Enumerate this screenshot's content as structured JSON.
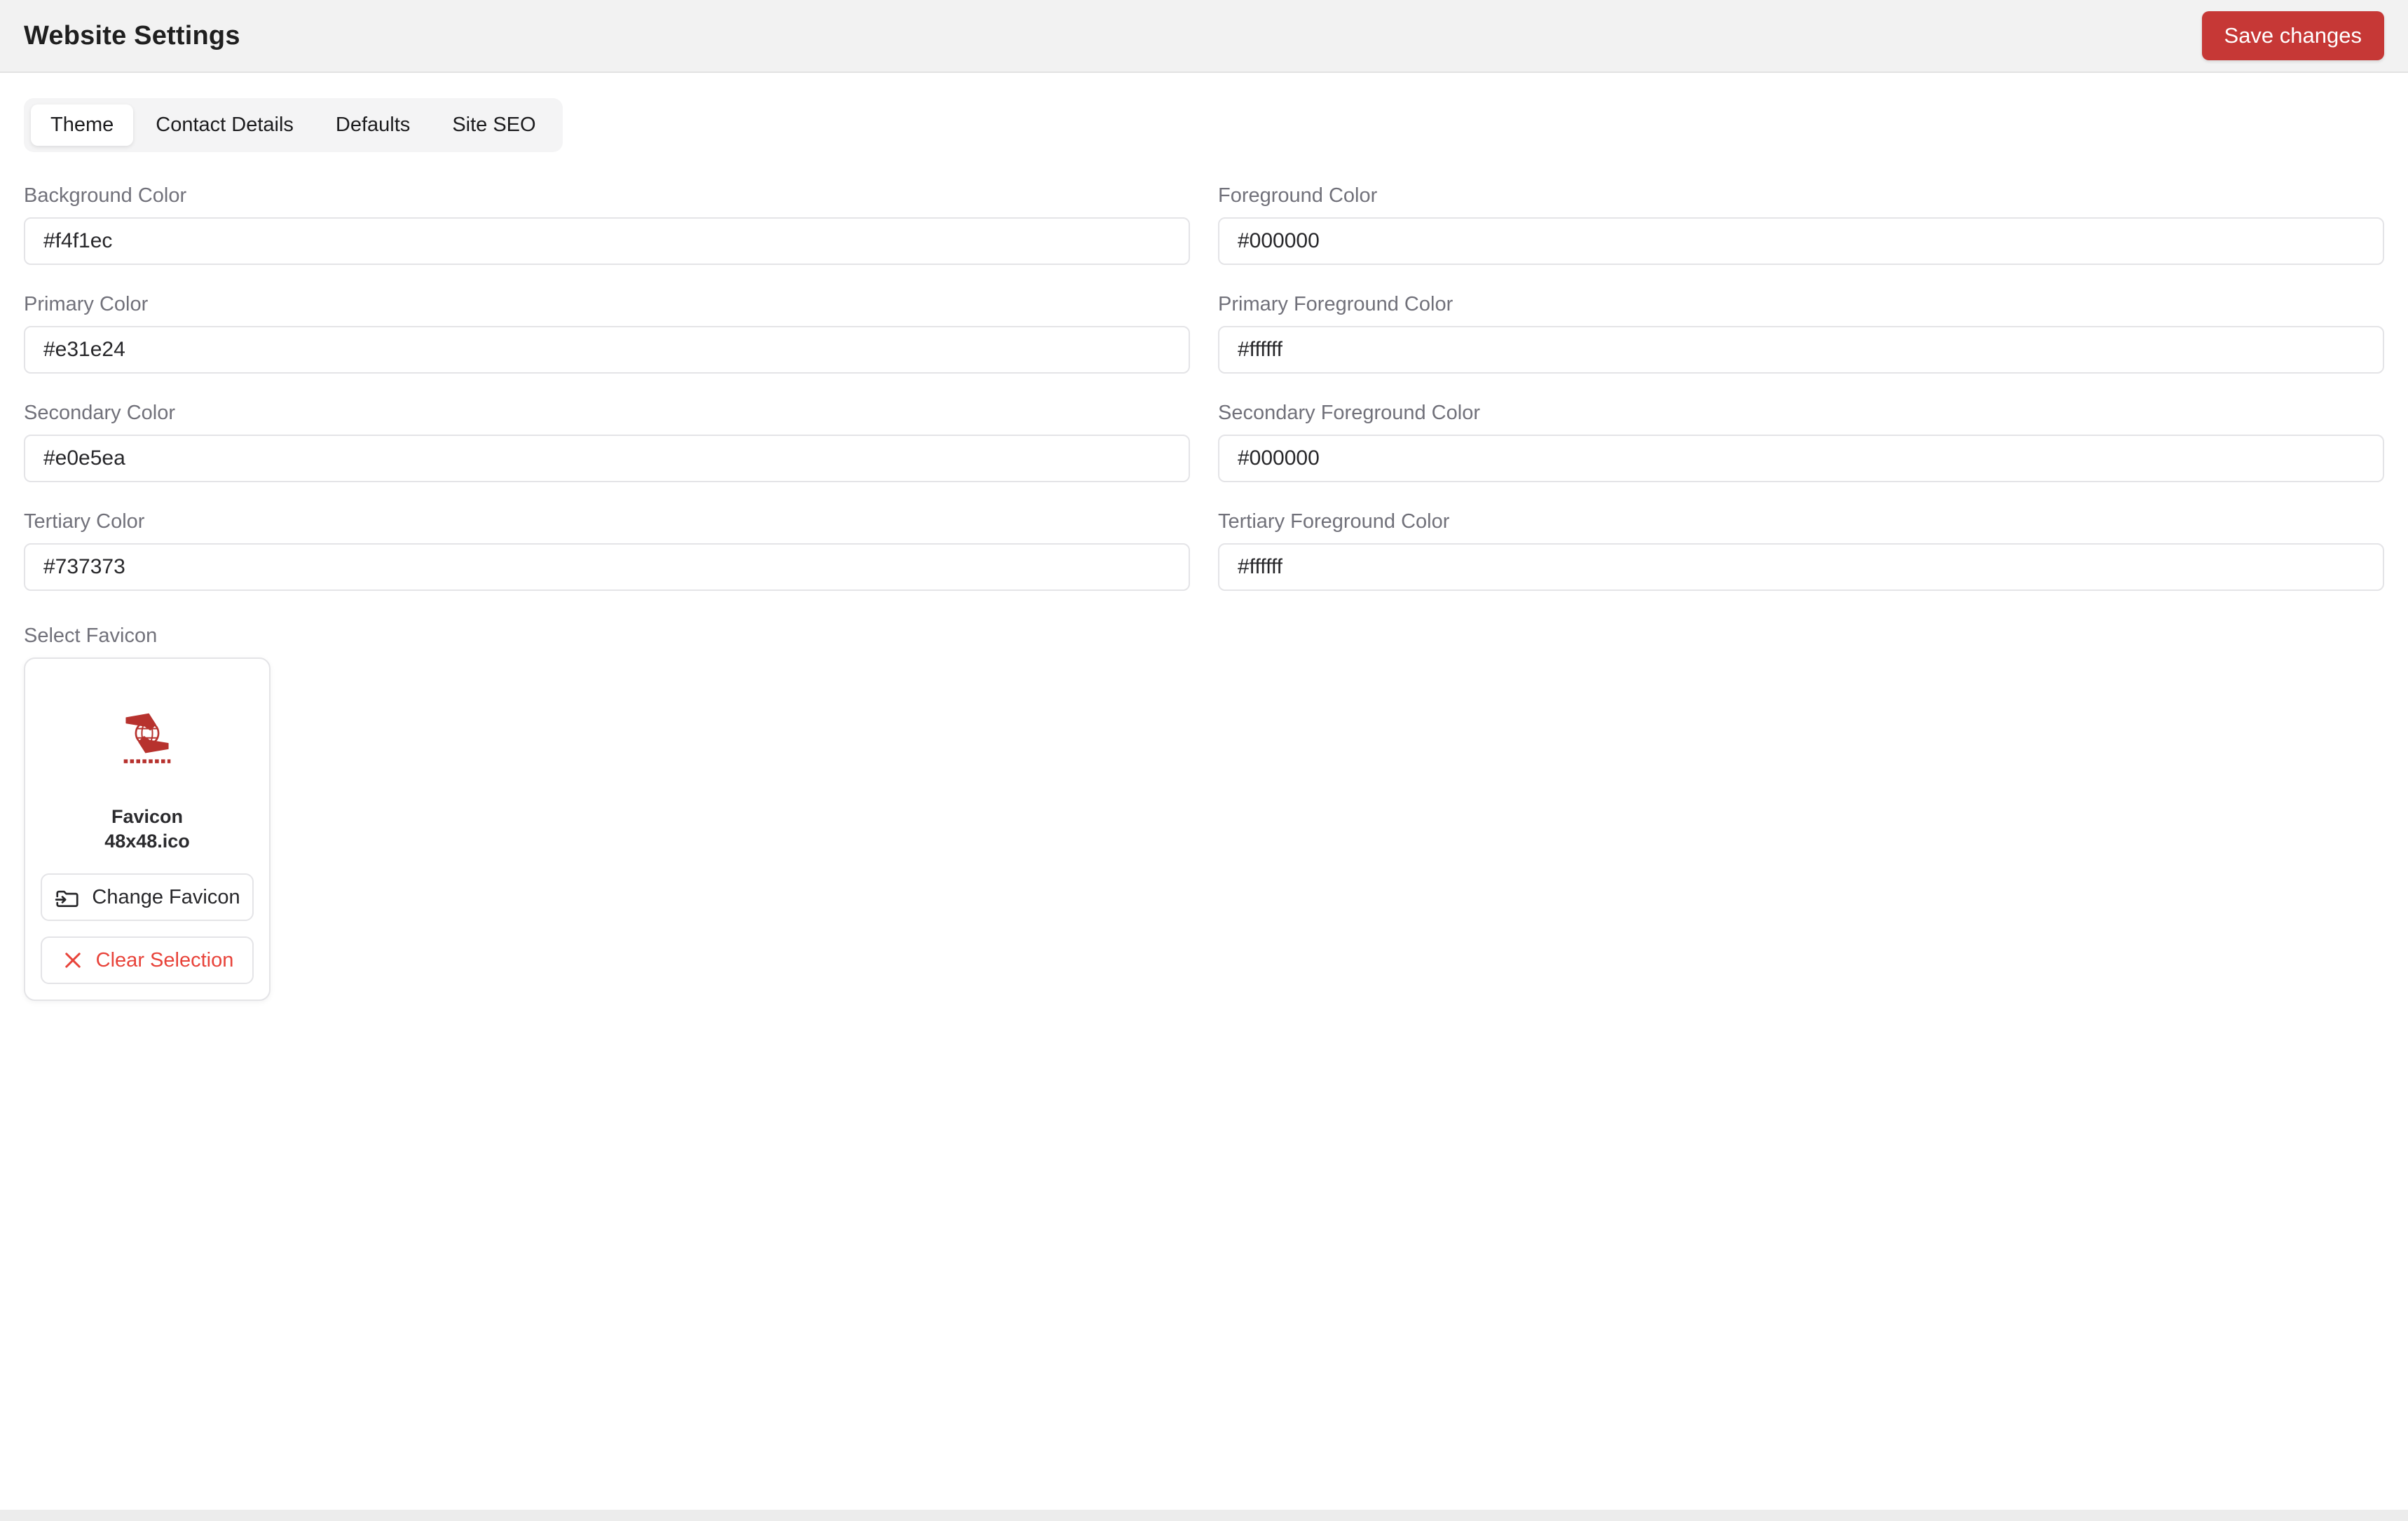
{
  "header": {
    "title": "Website Settings",
    "save_label": "Save changes"
  },
  "tabs": [
    {
      "label": "Theme",
      "active": true
    },
    {
      "label": "Contact Details",
      "active": false
    },
    {
      "label": "Defaults",
      "active": false
    },
    {
      "label": "Site SEO",
      "active": false
    }
  ],
  "fields": [
    {
      "label": "Background Color",
      "value": "#f4f1ec"
    },
    {
      "label": "Foreground Color",
      "value": "#000000"
    },
    {
      "label": "Primary Color",
      "value": "#e31e24"
    },
    {
      "label": "Primary Foreground Color",
      "value": "#ffffff"
    },
    {
      "label": "Secondary Color",
      "value": "#e0e5ea"
    },
    {
      "label": "Secondary Foreground Color",
      "value": "#000000"
    },
    {
      "label": "Tertiary Color",
      "value": "#737373"
    },
    {
      "label": "Tertiary Foreground Color",
      "value": "#ffffff"
    }
  ],
  "favicon": {
    "section_label": "Select Favicon",
    "file_name_line1": "Favicon",
    "file_name_line2": "48x48.ico",
    "change_label": "Change Favicon",
    "clear_label": "Clear Selection",
    "preview_icon": "red-globe-ribbon-logo",
    "change_icon": "folder-move-icon",
    "clear_icon": "close-icon"
  },
  "colors": {
    "save_button": "#c63836",
    "destructive_text": "#e8433a",
    "logo_red": "#b7322e",
    "muted_bg": "#f4f4f5",
    "border": "#e4e4e7",
    "label_gray": "#71717a"
  }
}
